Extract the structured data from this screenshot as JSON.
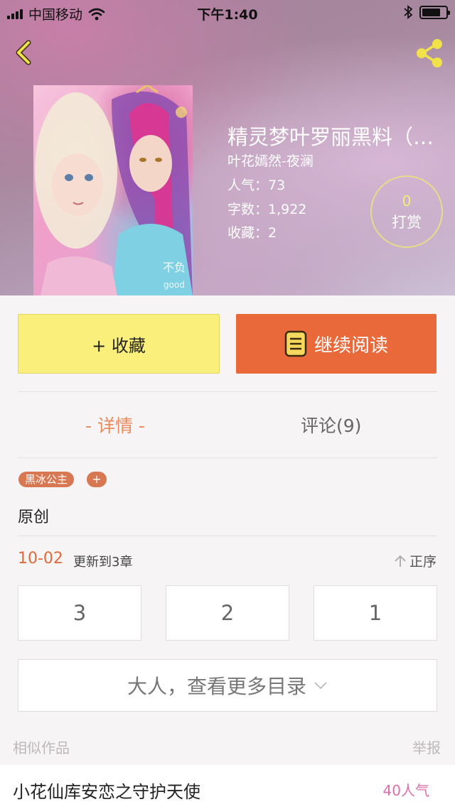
{
  "status_bar": {
    "carrier": "中国移动",
    "time": "下午1:40"
  },
  "book": {
    "title": "精灵梦叶罗丽黑料（…",
    "author": "叶花嫣然-夜澜",
    "popularity": "人气：73",
    "word_count": "字数：1,922",
    "favorites": "收藏：2",
    "reward_count": "0",
    "reward_label": "打赏",
    "cover_watermark": "不负good"
  },
  "actions": {
    "collect_label": "+ 收藏",
    "read_label": "继续阅读"
  },
  "tabs": {
    "detail": "- 详情 -",
    "comments": "评论(9)"
  },
  "tags": {
    "items": [
      "黑冰公主"
    ],
    "add": "+"
  },
  "category": "原创",
  "update": {
    "date": "10-02",
    "text": "更新到3章",
    "sort_label": "正序"
  },
  "chapters": [
    "3",
    "2",
    "1"
  ],
  "more_toc_label": "大人，查看更多目录",
  "similar": {
    "section_label": "相似作品",
    "report_label": "举报",
    "items": [
      {
        "title": "小花仙库安恋之守护天使",
        "popularity": "40人气"
      }
    ]
  },
  "colors": {
    "accent_orange": "#e9693b",
    "collect_yellow": "#f9ef7a",
    "tab_active": "#ea8a5d",
    "popularity_pink": "#e06fa9"
  }
}
